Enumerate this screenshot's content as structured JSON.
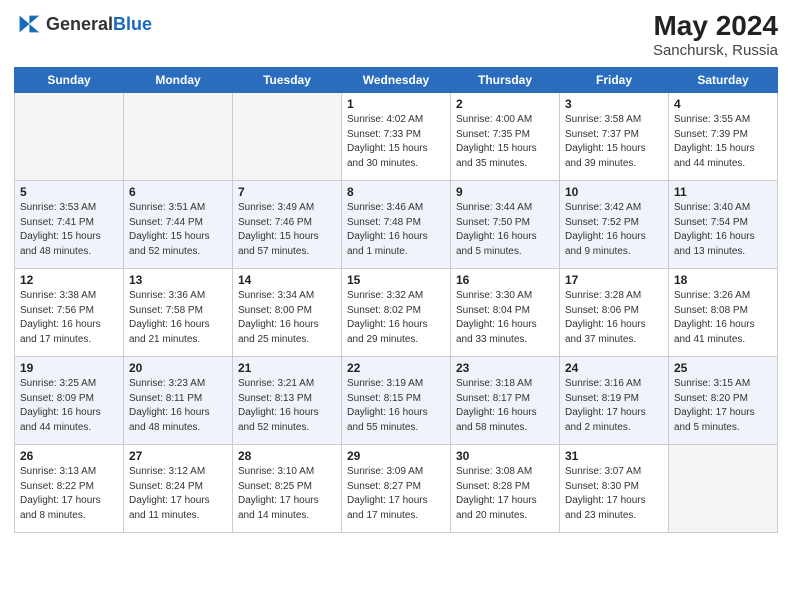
{
  "header": {
    "logo_general": "General",
    "logo_blue": "Blue",
    "title": "May 2024",
    "location": "Sanchursk, Russia"
  },
  "weekdays": [
    "Sunday",
    "Monday",
    "Tuesday",
    "Wednesday",
    "Thursday",
    "Friday",
    "Saturday"
  ],
  "weeks": [
    [
      {
        "day": "",
        "info": ""
      },
      {
        "day": "",
        "info": ""
      },
      {
        "day": "",
        "info": ""
      },
      {
        "day": "1",
        "info": "Sunrise: 4:02 AM\nSunset: 7:33 PM\nDaylight: 15 hours\nand 30 minutes."
      },
      {
        "day": "2",
        "info": "Sunrise: 4:00 AM\nSunset: 7:35 PM\nDaylight: 15 hours\nand 35 minutes."
      },
      {
        "day": "3",
        "info": "Sunrise: 3:58 AM\nSunset: 7:37 PM\nDaylight: 15 hours\nand 39 minutes."
      },
      {
        "day": "4",
        "info": "Sunrise: 3:55 AM\nSunset: 7:39 PM\nDaylight: 15 hours\nand 44 minutes."
      }
    ],
    [
      {
        "day": "5",
        "info": "Sunrise: 3:53 AM\nSunset: 7:41 PM\nDaylight: 15 hours\nand 48 minutes."
      },
      {
        "day": "6",
        "info": "Sunrise: 3:51 AM\nSunset: 7:44 PM\nDaylight: 15 hours\nand 52 minutes."
      },
      {
        "day": "7",
        "info": "Sunrise: 3:49 AM\nSunset: 7:46 PM\nDaylight: 15 hours\nand 57 minutes."
      },
      {
        "day": "8",
        "info": "Sunrise: 3:46 AM\nSunset: 7:48 PM\nDaylight: 16 hours\nand 1 minute."
      },
      {
        "day": "9",
        "info": "Sunrise: 3:44 AM\nSunset: 7:50 PM\nDaylight: 16 hours\nand 5 minutes."
      },
      {
        "day": "10",
        "info": "Sunrise: 3:42 AM\nSunset: 7:52 PM\nDaylight: 16 hours\nand 9 minutes."
      },
      {
        "day": "11",
        "info": "Sunrise: 3:40 AM\nSunset: 7:54 PM\nDaylight: 16 hours\nand 13 minutes."
      }
    ],
    [
      {
        "day": "12",
        "info": "Sunrise: 3:38 AM\nSunset: 7:56 PM\nDaylight: 16 hours\nand 17 minutes."
      },
      {
        "day": "13",
        "info": "Sunrise: 3:36 AM\nSunset: 7:58 PM\nDaylight: 16 hours\nand 21 minutes."
      },
      {
        "day": "14",
        "info": "Sunrise: 3:34 AM\nSunset: 8:00 PM\nDaylight: 16 hours\nand 25 minutes."
      },
      {
        "day": "15",
        "info": "Sunrise: 3:32 AM\nSunset: 8:02 PM\nDaylight: 16 hours\nand 29 minutes."
      },
      {
        "day": "16",
        "info": "Sunrise: 3:30 AM\nSunset: 8:04 PM\nDaylight: 16 hours\nand 33 minutes."
      },
      {
        "day": "17",
        "info": "Sunrise: 3:28 AM\nSunset: 8:06 PM\nDaylight: 16 hours\nand 37 minutes."
      },
      {
        "day": "18",
        "info": "Sunrise: 3:26 AM\nSunset: 8:08 PM\nDaylight: 16 hours\nand 41 minutes."
      }
    ],
    [
      {
        "day": "19",
        "info": "Sunrise: 3:25 AM\nSunset: 8:09 PM\nDaylight: 16 hours\nand 44 minutes."
      },
      {
        "day": "20",
        "info": "Sunrise: 3:23 AM\nSunset: 8:11 PM\nDaylight: 16 hours\nand 48 minutes."
      },
      {
        "day": "21",
        "info": "Sunrise: 3:21 AM\nSunset: 8:13 PM\nDaylight: 16 hours\nand 52 minutes."
      },
      {
        "day": "22",
        "info": "Sunrise: 3:19 AM\nSunset: 8:15 PM\nDaylight: 16 hours\nand 55 minutes."
      },
      {
        "day": "23",
        "info": "Sunrise: 3:18 AM\nSunset: 8:17 PM\nDaylight: 16 hours\nand 58 minutes."
      },
      {
        "day": "24",
        "info": "Sunrise: 3:16 AM\nSunset: 8:19 PM\nDaylight: 17 hours\nand 2 minutes."
      },
      {
        "day": "25",
        "info": "Sunrise: 3:15 AM\nSunset: 8:20 PM\nDaylight: 17 hours\nand 5 minutes."
      }
    ],
    [
      {
        "day": "26",
        "info": "Sunrise: 3:13 AM\nSunset: 8:22 PM\nDaylight: 17 hours\nand 8 minutes."
      },
      {
        "day": "27",
        "info": "Sunrise: 3:12 AM\nSunset: 8:24 PM\nDaylight: 17 hours\nand 11 minutes."
      },
      {
        "day": "28",
        "info": "Sunrise: 3:10 AM\nSunset: 8:25 PM\nDaylight: 17 hours\nand 14 minutes."
      },
      {
        "day": "29",
        "info": "Sunrise: 3:09 AM\nSunset: 8:27 PM\nDaylight: 17 hours\nand 17 minutes."
      },
      {
        "day": "30",
        "info": "Sunrise: 3:08 AM\nSunset: 8:28 PM\nDaylight: 17 hours\nand 20 minutes."
      },
      {
        "day": "31",
        "info": "Sunrise: 3:07 AM\nSunset: 8:30 PM\nDaylight: 17 hours\nand 23 minutes."
      },
      {
        "day": "",
        "info": ""
      }
    ]
  ]
}
